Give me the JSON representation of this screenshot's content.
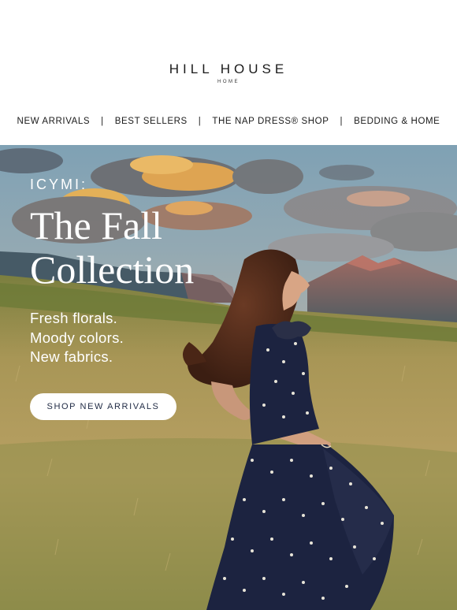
{
  "brand": {
    "name": "HILL HOUSE",
    "sub": "HOME"
  },
  "nav": {
    "items": [
      {
        "label": "NEW ARRIVALS"
      },
      {
        "label": "BEST SELLERS"
      },
      {
        "label": "THE NAP DRESS® SHOP"
      },
      {
        "label": "BEDDING & HOME"
      }
    ],
    "separator": "|"
  },
  "hero": {
    "eyebrow": "ICYMI:",
    "headline_line1": "The Fall",
    "headline_line2": "Collection",
    "sub_lines": [
      "Fresh florals.",
      "Moody colors.",
      "New fabrics."
    ],
    "cta_label": "SHOP NEW ARRIVALS",
    "image_subject": "woman-in-navy-floral-dress-walking-in-meadow"
  },
  "colors": {
    "text_dark": "#1a1a1a",
    "cta_text": "#1f2a44",
    "dress_navy": "#1c2340",
    "sky_blue": "#7e9fb0",
    "cloud_orange": "#e9a64b",
    "field_gold": "#b59a5a",
    "field_green": "#6f7a3c"
  }
}
